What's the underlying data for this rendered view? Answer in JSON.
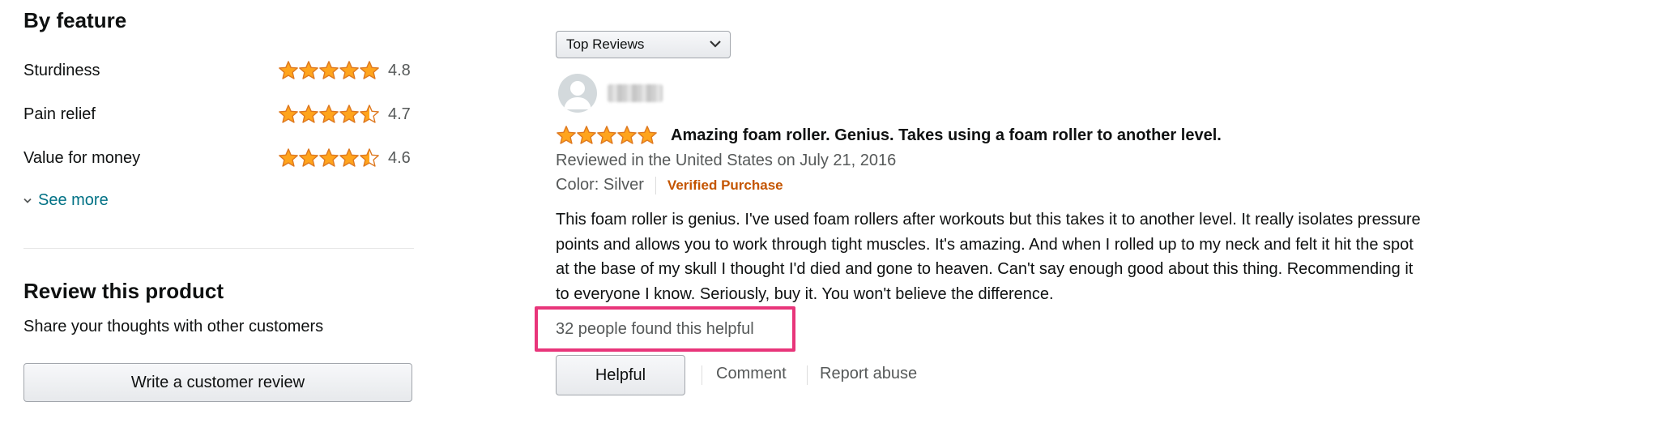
{
  "colors": {
    "star": "#ffa41c",
    "star_stroke": "#de7921",
    "link": "#007185",
    "verified": "#c45500",
    "highlight": "#e8357a"
  },
  "features": {
    "title": "By feature",
    "items": [
      {
        "label": "Sturdiness",
        "rating": 4.8,
        "score": "4.8"
      },
      {
        "label": "Pain relief",
        "rating": 4.7,
        "score": "4.7"
      },
      {
        "label": "Value for money",
        "rating": 4.6,
        "score": "4.6"
      }
    ],
    "see_more": "See more"
  },
  "review_product": {
    "title": "Review this product",
    "subtitle": "Share your thoughts with other customers",
    "button": "Write a customer review"
  },
  "sort": {
    "selected": "Top Reviews"
  },
  "review": {
    "rating": 5,
    "headline": "Amazing foam roller. Genius. Takes using a foam roller to another level.",
    "date": "Reviewed in the United States on July 21, 2016",
    "color": "Color: Silver",
    "verified": "Verified Purchase",
    "body": "This foam roller is genius. I've used foam rollers after workouts but this takes it to another level. It really isolates pressure points and allows you to work through tight muscles. It's amazing. And when I rolled up to my neck and felt it hit the spot at the base of my skull I thought I'd died and gone to heaven. Can't say enough good about this thing. Recommending it to everyone I know. Seriously, buy it. You won't believe the difference.",
    "helpful_count": "32 people found this helpful",
    "helpful_button": "Helpful",
    "comment": "Comment",
    "report": "Report abuse"
  }
}
